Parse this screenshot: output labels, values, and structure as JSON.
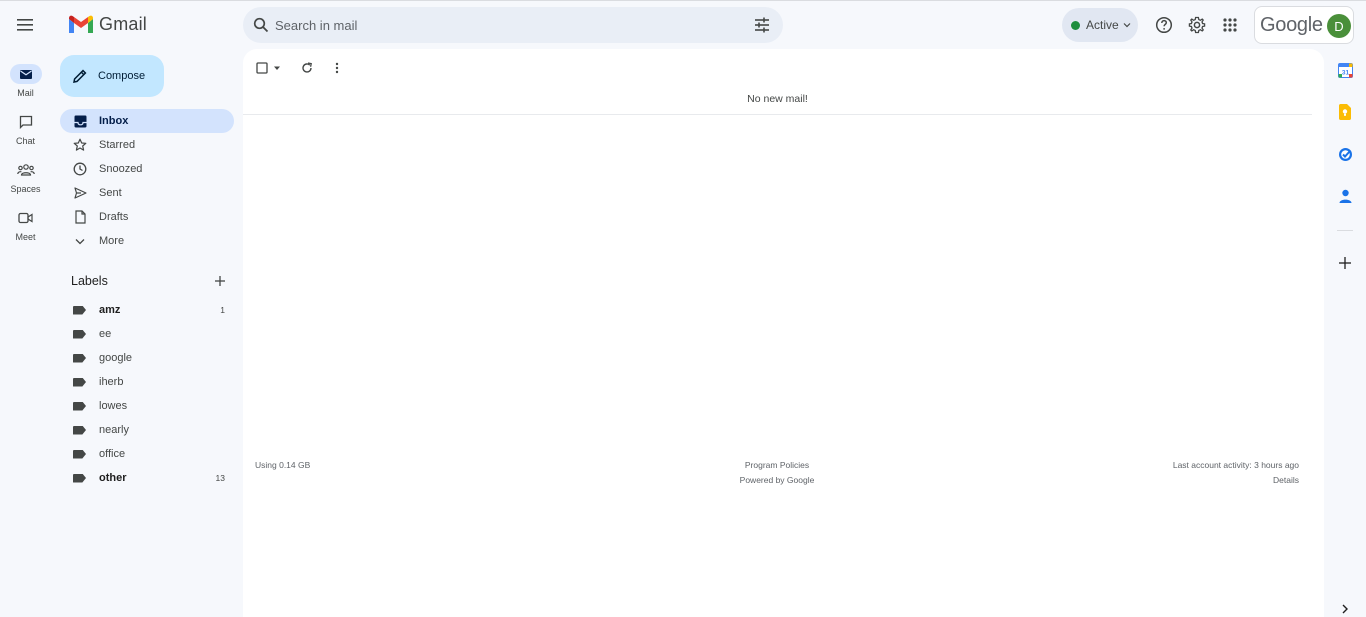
{
  "header": {
    "app_name": "Gmail",
    "search_placeholder": "Search in mail",
    "status": "Active",
    "account_brand": "Google",
    "avatar_letter": "D"
  },
  "rail": [
    {
      "label": "Mail",
      "icon": "mail-icon"
    },
    {
      "label": "Chat",
      "icon": "chat-icon"
    },
    {
      "label": "Spaces",
      "icon": "spaces-icon"
    },
    {
      "label": "Meet",
      "icon": "meet-icon"
    }
  ],
  "compose_label": "Compose",
  "nav": [
    {
      "label": "Inbox",
      "icon": "inbox-icon"
    },
    {
      "label": "Starred",
      "icon": "star-icon"
    },
    {
      "label": "Snoozed",
      "icon": "clock-icon"
    },
    {
      "label": "Sent",
      "icon": "send-icon"
    },
    {
      "label": "Drafts",
      "icon": "draft-icon"
    },
    {
      "label": "More",
      "icon": "chevron-down-icon"
    }
  ],
  "labels_header": "Labels",
  "labels": [
    {
      "name": "amz",
      "count": "1"
    },
    {
      "name": "ee",
      "count": ""
    },
    {
      "name": "google",
      "count": ""
    },
    {
      "name": "iherb",
      "count": ""
    },
    {
      "name": "lowes",
      "count": ""
    },
    {
      "name": "nearly",
      "count": ""
    },
    {
      "name": "office",
      "count": ""
    },
    {
      "name": "other",
      "count": "13"
    }
  ],
  "main": {
    "empty_message": "No new mail!",
    "storage": "Using 0.14 GB",
    "policies": "Program Policies",
    "powered_by": "Powered by Google",
    "last_activity": "Last account activity: 3 hours ago",
    "details": "Details"
  },
  "colors": {
    "background": "#f6f8fc",
    "compose": "#c2e7ff",
    "selected": "#d3e3fd",
    "active_dot": "#1e8e3e",
    "avatar": "#4a8f3a"
  }
}
